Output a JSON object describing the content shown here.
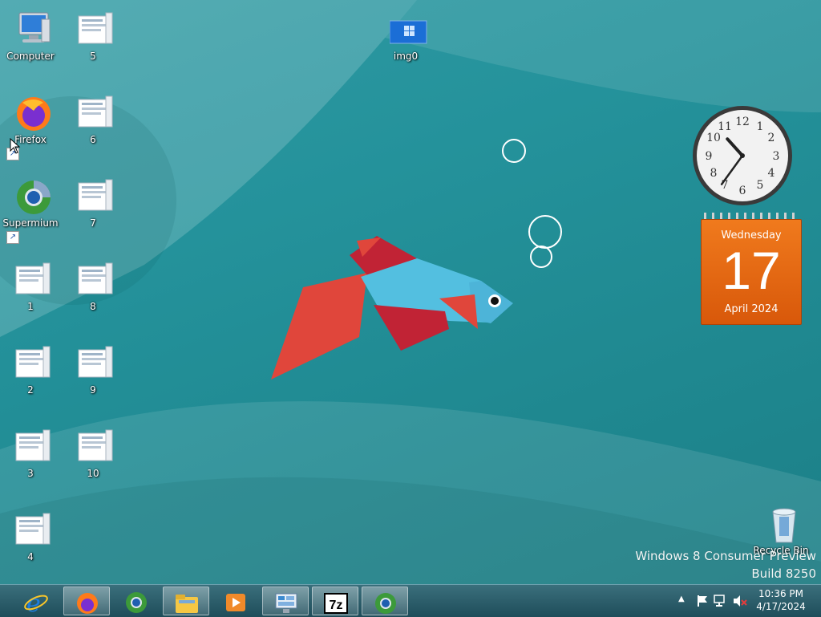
{
  "desktop": {
    "icons": [
      {
        "label": "Computer"
      },
      {
        "label": "Firefox"
      },
      {
        "label": "Supermium"
      },
      {
        "label": "1"
      },
      {
        "label": "2"
      },
      {
        "label": "3"
      },
      {
        "label": "4"
      },
      {
        "label": "5"
      },
      {
        "label": "6"
      },
      {
        "label": "7"
      },
      {
        "label": "8"
      },
      {
        "label": "9"
      },
      {
        "label": "10"
      },
      {
        "label": "img0"
      },
      {
        "label": "Recycle Bin"
      }
    ],
    "watermark": {
      "line1": "Windows 8 Consumer Preview",
      "line2": "Build 8250"
    }
  },
  "gadgets": {
    "clock": {
      "hour": 10,
      "minute": 36
    },
    "calendar": {
      "weekday": "Wednesday",
      "day": "17",
      "month_year": "April 2024",
      "accent": "#e2650f"
    }
  },
  "taskbar": {
    "buttons": [
      {
        "name": "Internet Explorer",
        "icon": "ie-icon"
      },
      {
        "name": "Firefox",
        "icon": "firefox-icon"
      },
      {
        "name": "Supermium",
        "icon": "supermium-icon"
      },
      {
        "name": "File Explorer",
        "icon": "folder-icon"
      },
      {
        "name": "Media Player",
        "icon": "media-player-icon"
      },
      {
        "name": "Control Panel",
        "icon": "control-panel-icon"
      },
      {
        "name": "7-Zip",
        "icon": "7zip-icon"
      },
      {
        "name": "Supermium",
        "icon": "supermium-icon"
      }
    ],
    "tray": {
      "time": "10:36 PM",
      "date": "4/17/2024"
    }
  },
  "colors": {
    "taskbar": "#2b5f6c",
    "desktop": "#24929b"
  }
}
